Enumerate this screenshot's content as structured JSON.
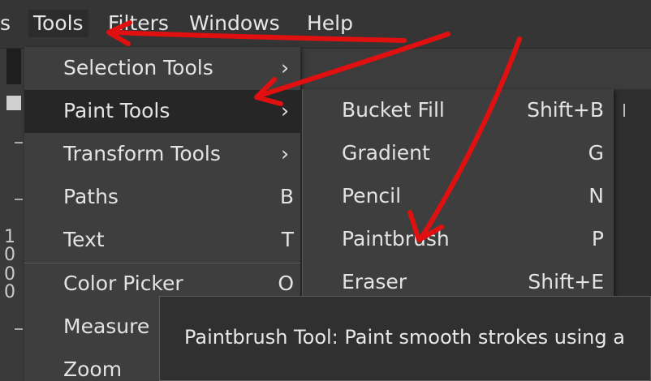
{
  "menubar": {
    "items": [
      {
        "label": "s"
      },
      {
        "label": "Tools"
      },
      {
        "label": "Filters"
      },
      {
        "label": "Windows"
      },
      {
        "label": "Help"
      }
    ]
  },
  "left_strip": {
    "numbers": [
      "1",
      "0",
      "0",
      "0"
    ]
  },
  "tools_menu": {
    "items": [
      {
        "label": "Selection Tools",
        "shortcut": "›"
      },
      {
        "label": "Paint Tools",
        "shortcut": "›"
      },
      {
        "label": "Transform Tools",
        "shortcut": "›"
      },
      {
        "label": "Paths",
        "shortcut": "B"
      },
      {
        "label": "Text",
        "shortcut": "T"
      },
      {
        "label": "Color Picker",
        "shortcut": "O"
      },
      {
        "label": "Measure",
        "shortcut": ""
      },
      {
        "label": "Zoom",
        "shortcut": ""
      }
    ]
  },
  "paint_tools_menu": {
    "items": [
      {
        "label": "Bucket Fill",
        "shortcut": "Shift+B"
      },
      {
        "label": "Gradient",
        "shortcut": "G"
      },
      {
        "label": "Pencil",
        "shortcut": "N"
      },
      {
        "label": "Paintbrush",
        "shortcut": "P"
      },
      {
        "label": "Eraser",
        "shortcut": "Shift+E"
      }
    ]
  },
  "tooltip": {
    "text": "Paintbrush Tool: Paint smooth strokes using a"
  },
  "colors": {
    "annotation_arrow": "#e01010",
    "menu_bg": "#3e3e3e",
    "highlight_bg": "#262626"
  },
  "icons": [
    "submenu-arrow-icon",
    "annotation-arrow-icon"
  ]
}
